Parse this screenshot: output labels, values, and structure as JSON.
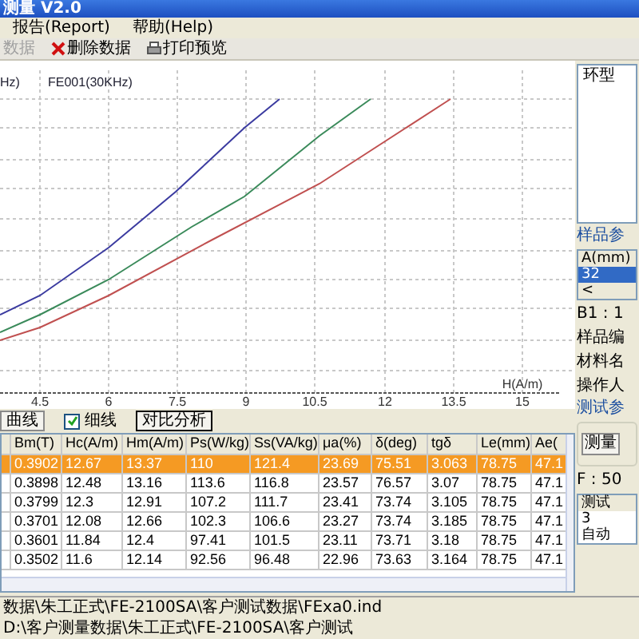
{
  "window": {
    "title": "测量 V2.0"
  },
  "menu": [
    {
      "label": "报告(Report)"
    },
    {
      "label": "帮助(Help)"
    }
  ],
  "toolbar": [
    {
      "label": "数据",
      "disabled": true,
      "kind": "plain"
    },
    {
      "label": "删除数据",
      "disabled": false,
      "kind": "delete"
    },
    {
      "label": "打印预览",
      "disabled": false,
      "kind": "print"
    }
  ],
  "chart": {
    "legend": [
      "Hz)",
      "FE001(30KHz)"
    ],
    "x_tick_labels": [
      "4.5",
      "6",
      "7.5",
      "9",
      "10.5",
      "12",
      "13.5",
      "15"
    ],
    "x_axis_label": "H(A/m)"
  },
  "chart_controls": {
    "curve_button": "曲线",
    "fine_line": {
      "label": "细线",
      "checked": true
    },
    "compare_button": "对比分析"
  },
  "table": {
    "columns": [
      "",
      "Bm(T)",
      "Hc(A/m)",
      "Hm(A/m)",
      "Ps(W/kg)",
      "Ss(VA/kg)",
      "μa(%)",
      "δ(deg)",
      "tgδ",
      "Le(mm)",
      "Ae("
    ],
    "rows": [
      {
        "selected": true,
        "cells": [
          "",
          "0.3902",
          "12.67",
          "13.37",
          "110",
          "121.4",
          "23.69",
          "75.51",
          "3.063",
          "78.75",
          "47.1"
        ]
      },
      {
        "selected": false,
        "cells": [
          "",
          "0.3898",
          "12.48",
          "13.16",
          "113.6",
          "116.8",
          "23.57",
          "76.57",
          "3.07",
          "78.75",
          "47.1"
        ]
      },
      {
        "selected": false,
        "cells": [
          "",
          "0.3799",
          "12.3",
          "12.91",
          "107.2",
          "111.7",
          "23.41",
          "73.74",
          "3.105",
          "78.75",
          "47.1"
        ]
      },
      {
        "selected": false,
        "cells": [
          "",
          "0.3701",
          "12.08",
          "12.66",
          "102.3",
          "106.6",
          "23.27",
          "73.74",
          "3.185",
          "78.75",
          "47.1"
        ]
      },
      {
        "selected": false,
        "cells": [
          "",
          "0.3601",
          "11.84",
          "12.4",
          "97.41",
          "101.5",
          "23.11",
          "73.71",
          "3.18",
          "78.75",
          "47.1"
        ]
      },
      {
        "selected": false,
        "cells": [
          "",
          "0.3502",
          "11.6",
          "12.14",
          "92.56",
          "96.48",
          "22.96",
          "73.63",
          "3.164",
          "78.75",
          "47.1"
        ]
      }
    ]
  },
  "right_panel": {
    "shape_box": "环型",
    "sample_group": "样品参",
    "sample_table": {
      "header": "A(mm)",
      "rows": [
        {
          "value": "32",
          "selected": true
        }
      ],
      "scroll": "<"
    },
    "fields": [
      "B1 : 1",
      "样品编",
      "材料名",
      "操作人"
    ],
    "test_group": "测试参",
    "measure_button": "测量",
    "frequency": "F : 50",
    "test_table": [
      "测试",
      "3",
      "自动"
    ]
  },
  "status_bar": [
    "数据\\朱工正式\\FE-2100SA\\客户测试数据\\FExa0.ind",
    "D:\\客户测量数据\\朱工正式\\FE-2100SA\\客户测试"
  ]
}
